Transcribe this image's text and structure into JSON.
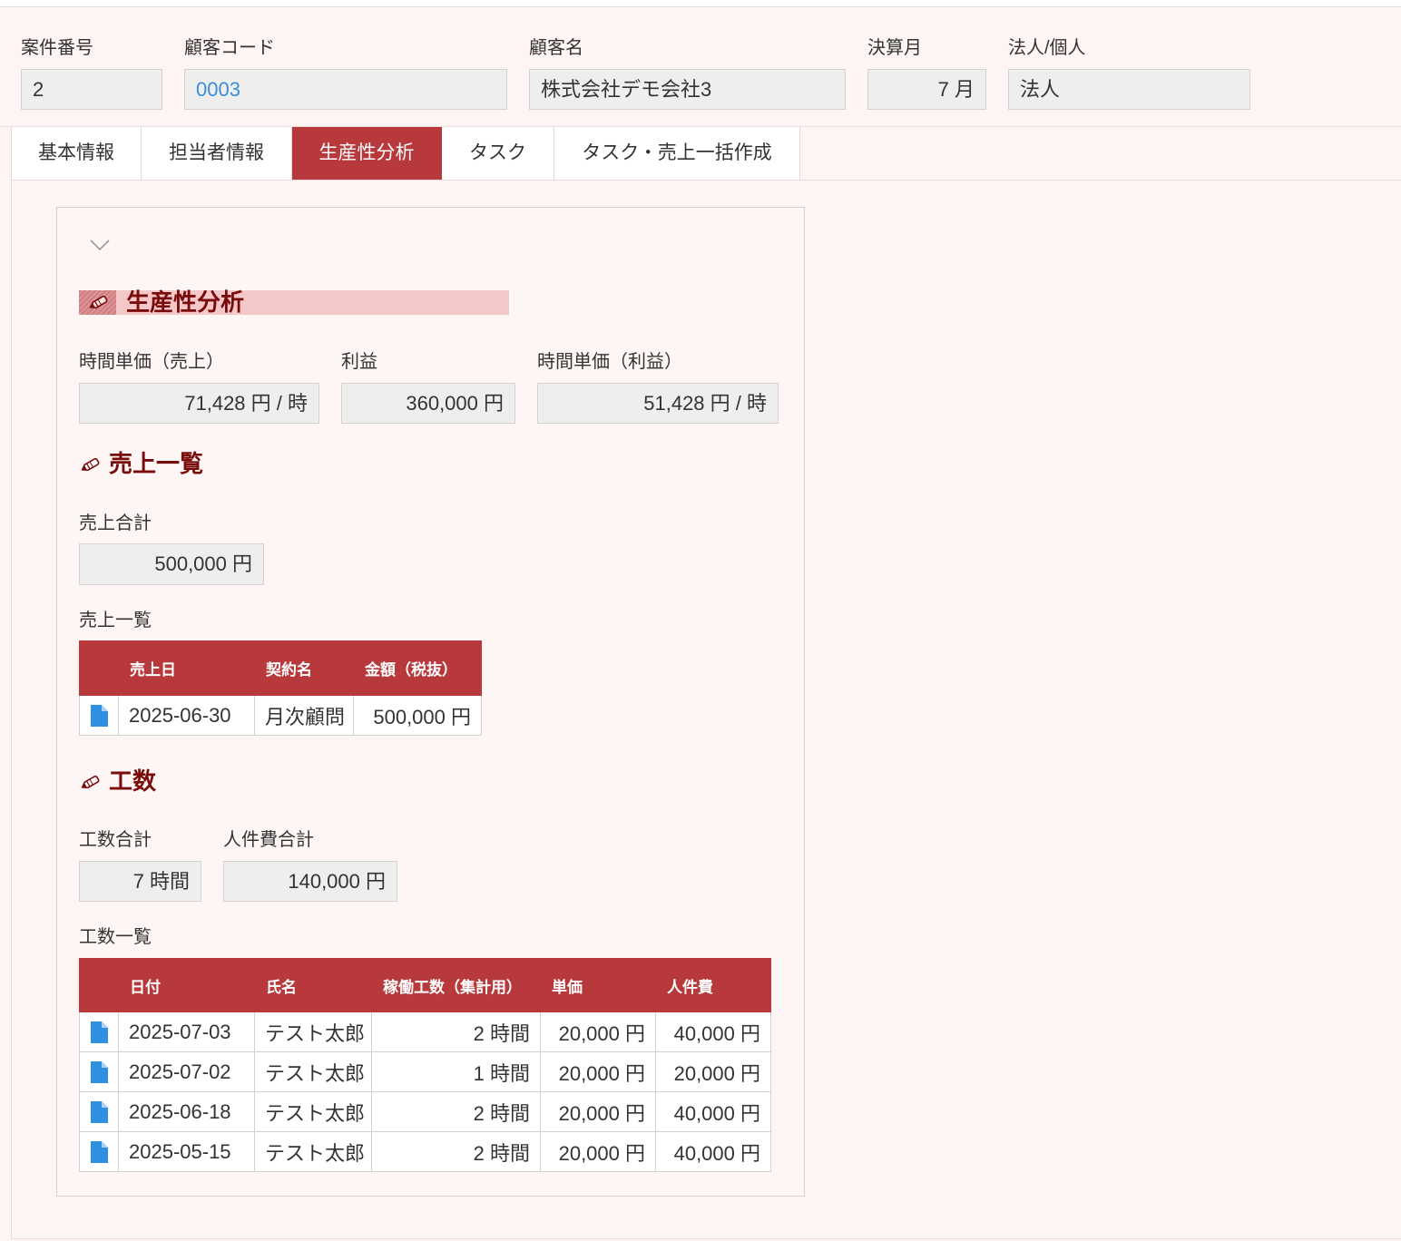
{
  "header": {
    "case_number": {
      "label": "案件番号",
      "value": "2"
    },
    "customer_code": {
      "label": "顧客コード",
      "value": "0003"
    },
    "customer_name": {
      "label": "顧客名",
      "value": "株式会社デモ会社3"
    },
    "fiscal_month": {
      "label": "決算月",
      "value": "7 月"
    },
    "entity_type": {
      "label": "法人/個人",
      "value": "法人"
    }
  },
  "tabs": [
    {
      "label": "基本情報",
      "active": false
    },
    {
      "label": "担当者情報",
      "active": false
    },
    {
      "label": "生産性分析",
      "active": true
    },
    {
      "label": "タスク",
      "active": false
    },
    {
      "label": "タスク・売上一括作成",
      "active": false
    }
  ],
  "productivity": {
    "collapse_icon": "chevron-down-icon",
    "title_icon": "pencil-icon",
    "title": "生産性分析",
    "metrics": [
      {
        "label": "時間単価（売上）",
        "value": "71,428 円 / 時"
      },
      {
        "label": "利益",
        "value": "360,000 円"
      },
      {
        "label": "時間単価（利益）",
        "value": "51,428 円 / 時"
      }
    ]
  },
  "sales": {
    "title_icon": "pencil-icon",
    "title": "売上一覧",
    "total_label": "売上合計",
    "total_value": "500,000 円",
    "list_label": "売上一覧",
    "row_icon": "document-icon",
    "columns": [
      "売上日",
      "契約名",
      "金額（税抜）"
    ],
    "rows": [
      {
        "date": "2025-06-30",
        "contract": "月次顧問",
        "amount": "500,000 円"
      }
    ]
  },
  "hours": {
    "title_icon": "pencil-icon",
    "title": "工数",
    "total_hours_label": "工数合計",
    "total_hours_value": "7 時間",
    "labor_cost_label": "人件費合計",
    "labor_cost_value": "140,000 円",
    "list_label": "工数一覧",
    "row_icon": "document-icon",
    "columns": [
      "日付",
      "氏名",
      "稼働工数（集計用）",
      "単価",
      "人件費"
    ],
    "rows": [
      {
        "date": "2025-07-03",
        "name": "テスト太郎",
        "hours": "2 時間",
        "unit_price": "20,000 円",
        "cost": "40,000 円"
      },
      {
        "date": "2025-07-02",
        "name": "テスト太郎",
        "hours": "1 時間",
        "unit_price": "20,000 円",
        "cost": "20,000 円"
      },
      {
        "date": "2025-06-18",
        "name": "テスト太郎",
        "hours": "2 時間",
        "unit_price": "20,000 円",
        "cost": "40,000 円"
      },
      {
        "date": "2025-05-15",
        "name": "テスト太郎",
        "hours": "2 時間",
        "unit_price": "20,000 円",
        "cost": "40,000 円"
      }
    ]
  },
  "colors": {
    "page_background": "#fdf4f3",
    "accent": "#b8393b",
    "heading_text": "#7a0b0b",
    "heading_highlight": "#f4c7c8",
    "link": "#3a8ed6",
    "document_icon": "#2f8fe0",
    "input_background": "#eeeeee"
  }
}
